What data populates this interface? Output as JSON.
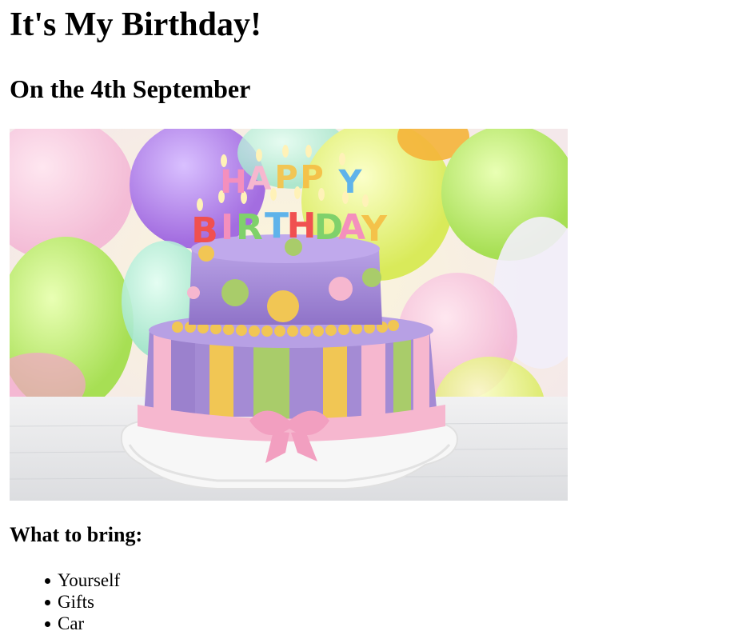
{
  "page": {
    "title": "It's My Birthday!",
    "subtitle": "On the 4th September",
    "bring_heading": "What to bring:",
    "bring_items": [
      {
        "label": "Yourself"
      },
      {
        "label": "Gifts"
      },
      {
        "label": "Car"
      }
    ]
  },
  "photo": {
    "candle_text_top": "HAPPY",
    "candle_text_bottom": "BIRTHDAY",
    "colors": {
      "cake_purple": "#a98fd6",
      "cake_pink": "#f6b7cf",
      "cake_yellow": "#f1c654",
      "cake_green": "#a9cc6a",
      "plate": "#f3f3f3",
      "table": "#e7e8ea"
    }
  }
}
